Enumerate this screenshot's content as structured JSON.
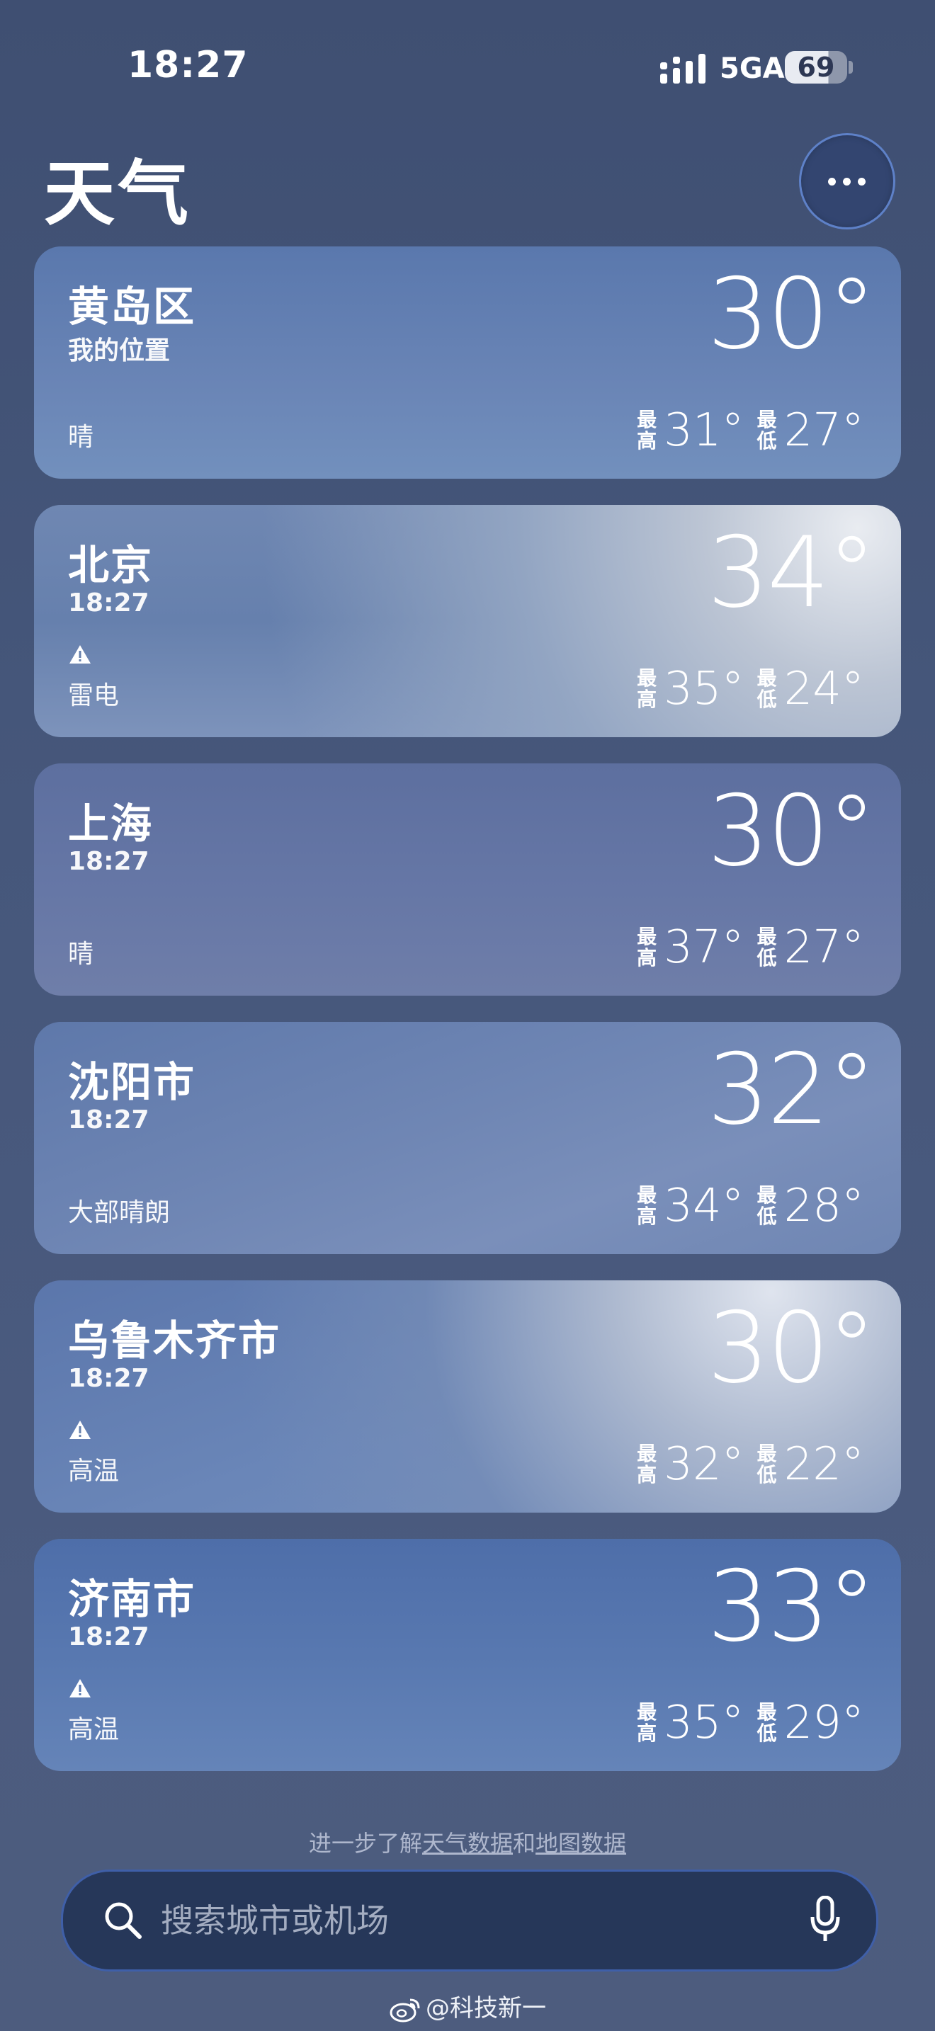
{
  "status_bar": {
    "time": "18:27",
    "network": "5GA",
    "battery": "69"
  },
  "header": {
    "title": "天气"
  },
  "cities": [
    {
      "name": "黄岛区",
      "subtitle": "我的位置",
      "condition": "晴",
      "temp": "30°",
      "high_label": "最高",
      "high": "31°",
      "low_label": "最低",
      "low": "27°",
      "warning": false
    },
    {
      "name": "北京",
      "subtitle": "18:27",
      "condition": "雷电",
      "temp": "34°",
      "high_label": "最高",
      "high": "35°",
      "low_label": "最低",
      "low": "24°",
      "warning": true
    },
    {
      "name": "上海",
      "subtitle": "18:27",
      "condition": "晴",
      "temp": "30°",
      "high_label": "最高",
      "high": "37°",
      "low_label": "最低",
      "low": "27°",
      "warning": false
    },
    {
      "name": "沈阳市",
      "subtitle": "18:27",
      "condition": "大部晴朗",
      "temp": "32°",
      "high_label": "最高",
      "high": "34°",
      "low_label": "最低",
      "low": "28°",
      "warning": false
    },
    {
      "name": "乌鲁木齐市",
      "subtitle": "18:27",
      "condition": "高温",
      "temp": "30°",
      "high_label": "最高",
      "high": "32°",
      "low_label": "最低",
      "low": "22°",
      "warning": true
    },
    {
      "name": "济南市",
      "subtitle": "18:27",
      "condition": "高温",
      "temp": "33°",
      "high_label": "最高",
      "high": "35°",
      "low_label": "最低",
      "low": "29°",
      "warning": true
    }
  ],
  "footer": {
    "prefix": "进一步了解",
    "link1": "天气数据",
    "and": "和",
    "link2": "地图数据"
  },
  "search": {
    "placeholder": "搜索城市或机场"
  },
  "watermark": "@科技新一",
  "icons": {
    "more": "ellipsis-icon",
    "search": "magnifier-icon",
    "mic": "microphone-icon",
    "warning": "warning-triangle-icon"
  }
}
